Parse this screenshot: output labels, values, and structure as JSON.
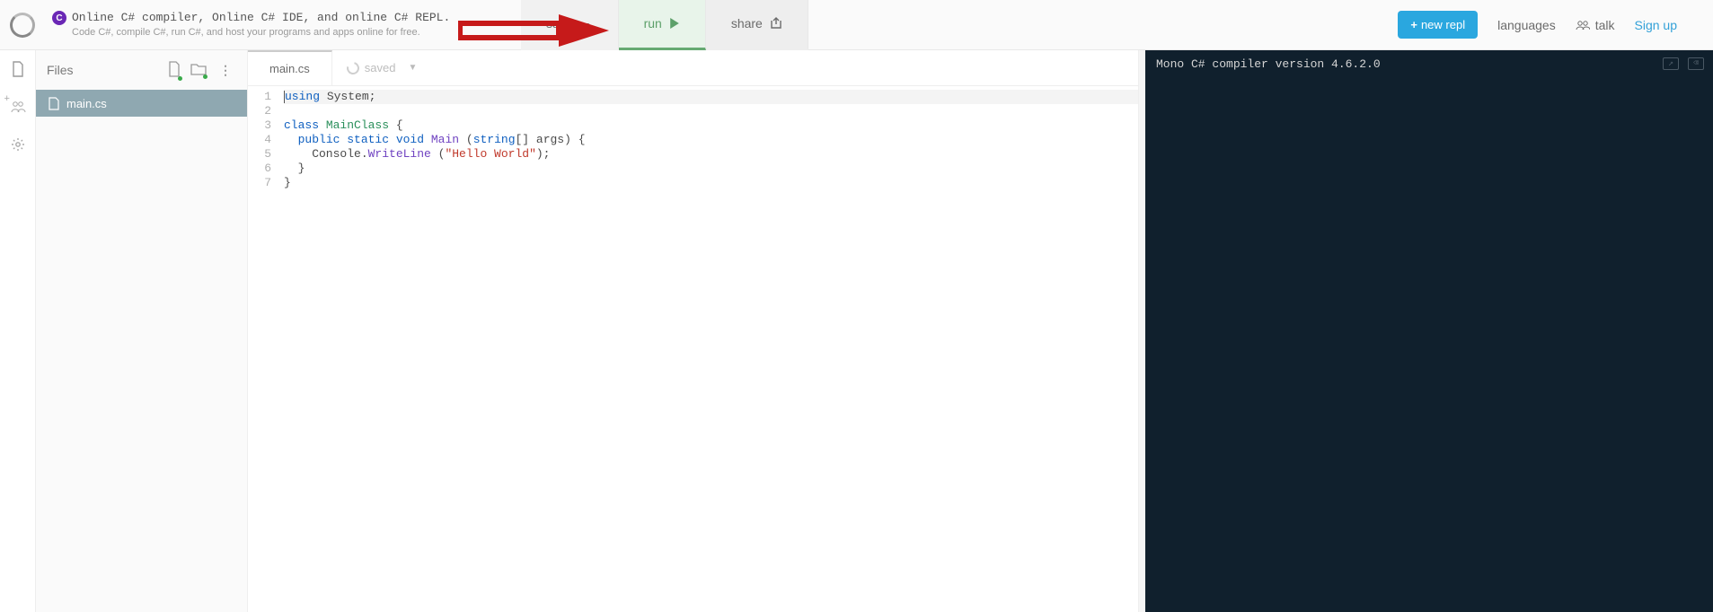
{
  "header": {
    "title_line1": "Online C# compiler, Online C# IDE, and online C# REPL.",
    "title_line2": "Code C#, compile C#, run C#, and host your programs and apps online for free.",
    "save_label": "save",
    "run_label": "run",
    "share_label": "share",
    "new_repl_label": "new repl",
    "languages_label": "languages",
    "talk_label": "talk",
    "signup_label": "Sign up"
  },
  "files": {
    "panel_label": "Files",
    "items": [
      "main.cs"
    ]
  },
  "editor": {
    "tab": "main.cs",
    "saved_label": "saved",
    "lines": [
      {
        "n": 1,
        "html": "<span class='kw'>using</span> System;"
      },
      {
        "n": 2,
        "html": ""
      },
      {
        "n": 3,
        "html": "<span class='kw'>class</span> <span class='cls'>MainClass</span> {"
      },
      {
        "n": 4,
        "html": "  <span class='kw'>public static void</span> <span class='mtd'>Main</span> (<span class='kw'>string</span>[] args) {"
      },
      {
        "n": 5,
        "html": "    Console.<span class='mtd'>WriteLine</span> (<span class='str'>\"Hello World\"</span>);"
      },
      {
        "n": 6,
        "html": "  }"
      },
      {
        "n": 7,
        "html": "}"
      }
    ]
  },
  "console": {
    "output": "Mono C# compiler version 4.6.2.0"
  }
}
